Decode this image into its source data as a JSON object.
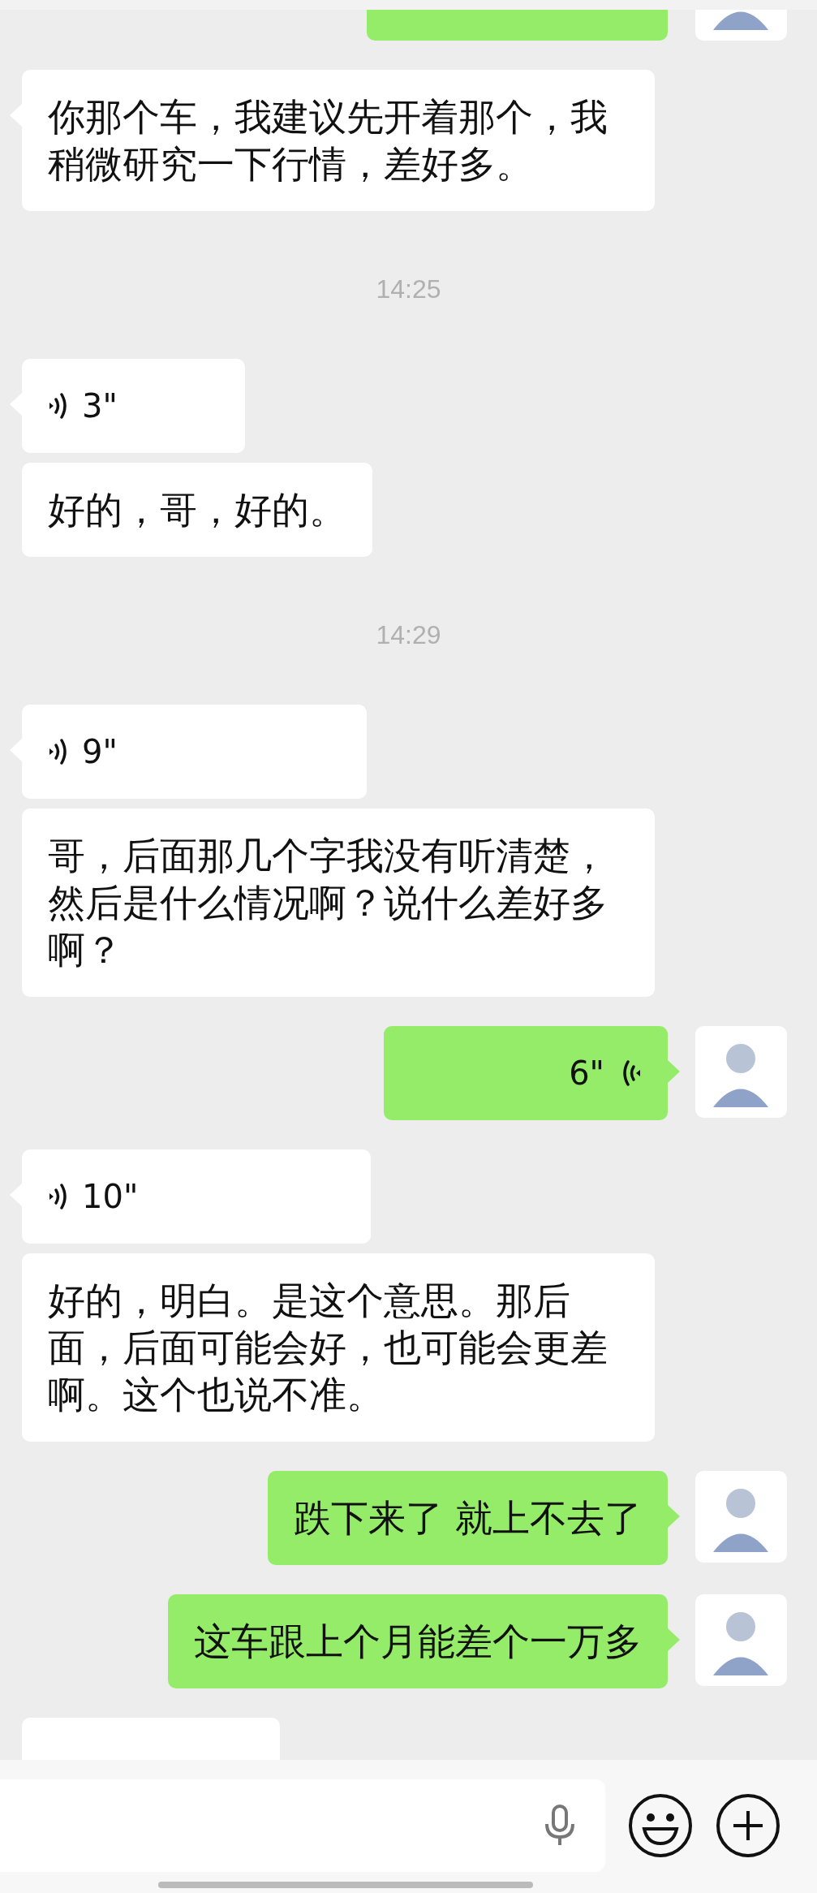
{
  "messages": [
    {
      "kind": "cut",
      "sent": true
    },
    {
      "kind": "text",
      "sent": false,
      "text": "你那个车，我建议先开着那个，我稍微研究一下行情，差好多。"
    },
    {
      "kind": "time",
      "text": "14:25"
    },
    {
      "kind": "voice",
      "sent": false,
      "text": "3\""
    },
    {
      "kind": "text",
      "sent": false,
      "text": "好的，哥，好的。"
    },
    {
      "kind": "time",
      "text": "14:29"
    },
    {
      "kind": "voice",
      "sent": false,
      "text": "9\""
    },
    {
      "kind": "text",
      "sent": false,
      "text": "哥，后面那几个字我没有听清楚，然后是什么情况啊？说什么差好多啊？"
    },
    {
      "kind": "voice",
      "sent": true,
      "text": "6\""
    },
    {
      "kind": "voice",
      "sent": false,
      "text": "10\""
    },
    {
      "kind": "text",
      "sent": false,
      "text": "好的，明白。是这个意思。那后面，后面可能会好，也可能会更差啊。这个也说不准。"
    },
    {
      "kind": "text",
      "sent": true,
      "text": "跌下来了 就上不去了"
    },
    {
      "kind": "text",
      "sent": true,
      "text": "这车跟上个月能差个一万多"
    },
    {
      "kind": "cut",
      "sent": false
    }
  ]
}
